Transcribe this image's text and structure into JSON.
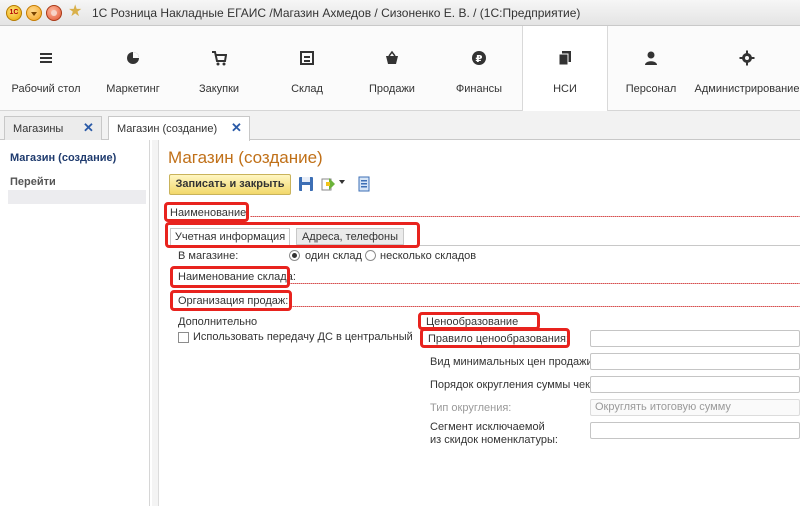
{
  "window": {
    "logo_text": "1С",
    "title": "1С Розница Накладные ЕГАИС /Магазин Ахмедов / Сизоненко Е. В. /  (1С:Предприятие)"
  },
  "sections": [
    {
      "label": "Рабочий стол",
      "icon": "menu-icon"
    },
    {
      "label": "Маркетинг",
      "icon": "pie-chart-icon"
    },
    {
      "label": "Закупки",
      "icon": "cart-icon"
    },
    {
      "label": "Склад",
      "icon": "warehouse-icon"
    },
    {
      "label": "Продажи",
      "icon": "basket-icon"
    },
    {
      "label": "Финансы",
      "icon": "ruble-icon"
    },
    {
      "label": "НСИ",
      "icon": "documents-icon"
    },
    {
      "label": "Персонал",
      "icon": "person-icon"
    },
    {
      "label": "Администрирование",
      "icon": "gear-icon"
    }
  ],
  "tabs": [
    {
      "label": "Магазины"
    },
    {
      "label": "Магазин (создание)"
    }
  ],
  "leftnav": {
    "current": "Магазин (создание)",
    "go": "Перейти"
  },
  "form": {
    "title": "Магазин (создание)",
    "save_close": "Записать и закрыть",
    "name_label": "Наименование:",
    "inner_tabs": [
      "Учетная информация",
      "Адреса, телефоны"
    ],
    "in_shop_label": "В магазине:",
    "radio_one": "один склад",
    "radio_many": "несколько складов",
    "warehouse_name_label": "Наименование склада:",
    "org_label": "Организация продаж:",
    "additional_label": "Дополнительно",
    "use_transfer_label": "Использовать передачу ДС в центральный офис",
    "pricing_label": "Ценообразование",
    "pricing_rule_label": "Правило ценообразования:",
    "min_prices_label": "Вид минимальных цен продажи:",
    "rounding_order_label": "Порядок округления суммы чека:",
    "rounding_type_label": "Тип округления:",
    "rounding_type_value": "Округлять итоговую сумму",
    "segment_label_1": "Сегмент исключаемой",
    "segment_label_2": "из скидок номенклатуры:"
  },
  "colors": {
    "accent": "#c07018",
    "highlight": "#e8231e",
    "tab_close": "#2a5aa7"
  }
}
